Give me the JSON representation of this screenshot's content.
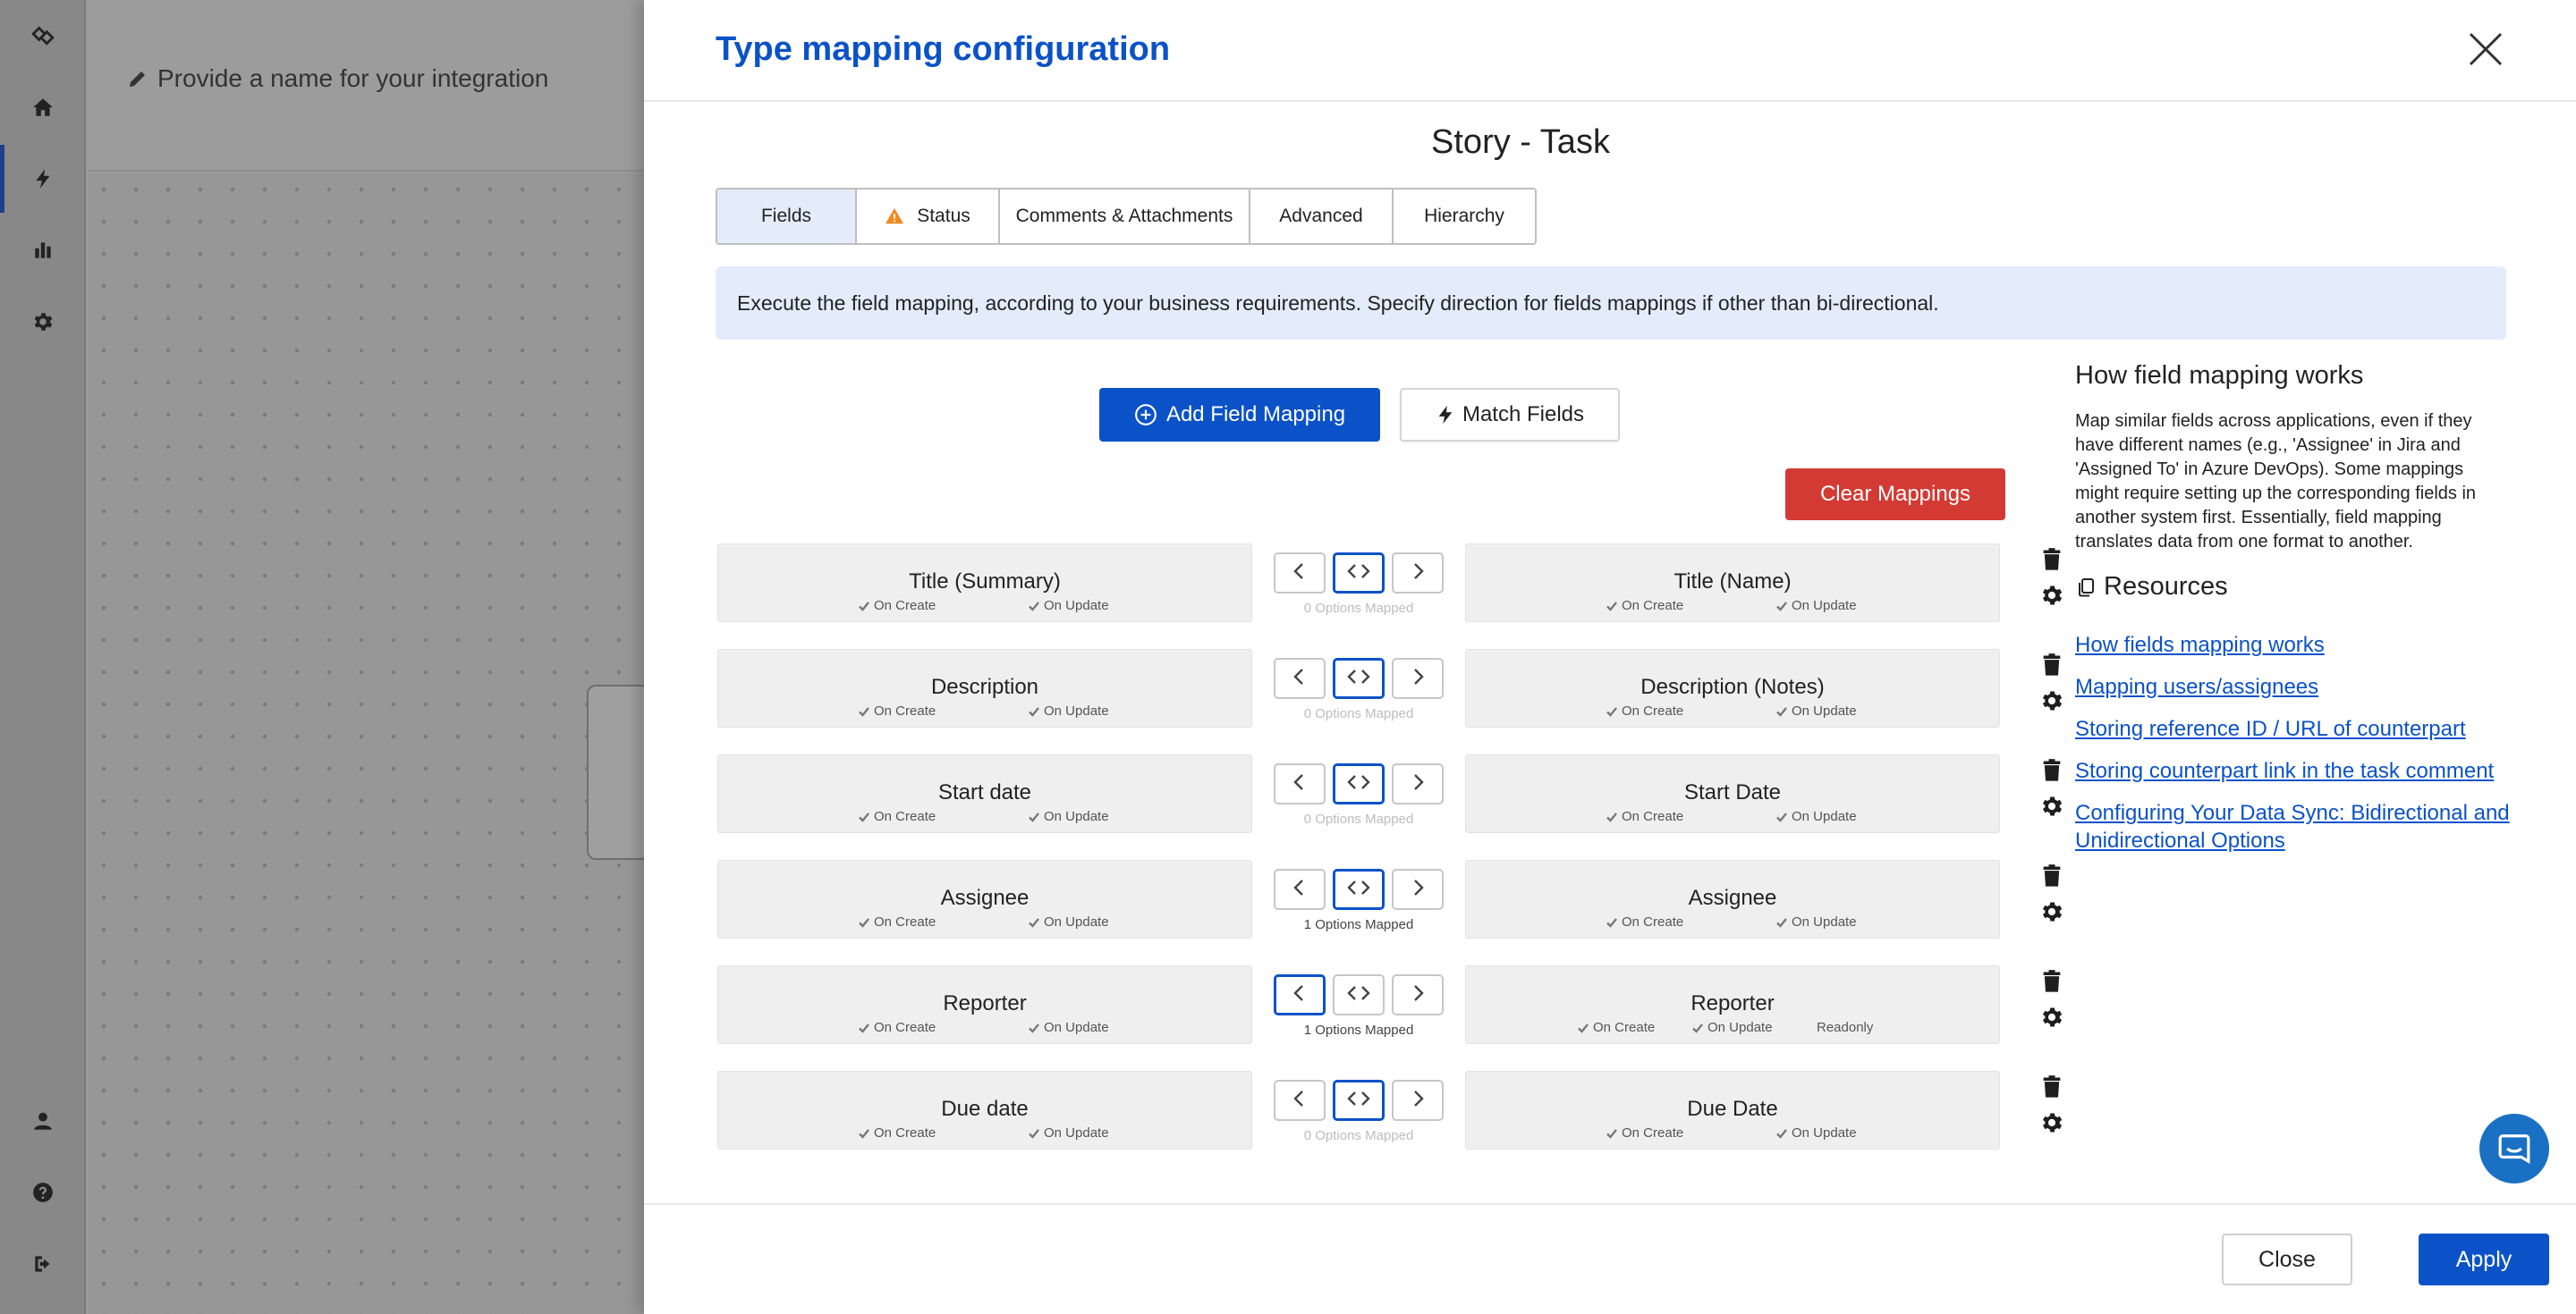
{
  "background": {
    "integration_name_placeholder": "Provide a name for your integration"
  },
  "modal": {
    "title": "Type mapping configuration",
    "subtitle": "Story - Task",
    "tabs": [
      {
        "label": "Fields",
        "active": true,
        "warning": false
      },
      {
        "label": "Status",
        "active": false,
        "warning": true
      },
      {
        "label": "Comments & Attachments",
        "active": false,
        "warning": false
      },
      {
        "label": "Advanced",
        "active": false,
        "warning": false
      },
      {
        "label": "Hierarchy",
        "active": false,
        "warning": false
      }
    ],
    "info_text": "Execute the field mapping, according to your business requirements. Specify direction for fields mappings if other than bi-directional.",
    "add_field_mapping_label": "Add Field Mapping",
    "match_fields_label": "Match Fields",
    "clear_mappings_label": "Clear Mappings",
    "flag_labels": {
      "on_create": "On Create",
      "on_update": "On Update",
      "readonly": "Readonly"
    },
    "mappings": [
      {
        "left": "Title (Summary)",
        "right": "Title (Name)",
        "direction": "both",
        "options": "0 Options Mapped",
        "readonly": false
      },
      {
        "left": "Description",
        "right": "Description (Notes)",
        "direction": "both",
        "options": "0 Options Mapped",
        "readonly": false
      },
      {
        "left": "Start date",
        "right": "Start Date",
        "direction": "both",
        "options": "0 Options Mapped",
        "readonly": false
      },
      {
        "left": "Assignee",
        "right": "Assignee",
        "direction": "both",
        "options": "1 Options Mapped",
        "readonly": false
      },
      {
        "left": "Reporter",
        "right": "Reporter",
        "direction": "left",
        "options": "1 Options Mapped",
        "readonly": true
      },
      {
        "left": "Due date",
        "right": "Due Date",
        "direction": "both",
        "options": "0 Options Mapped",
        "readonly": false
      }
    ],
    "help": {
      "title": "How field mapping works",
      "body": "Map similar fields across applications, even if they have different names (e.g., 'Assignee' in Jira and 'Assigned To' in Azure DevOps). Some mappings might require setting up the corresponding fields in another system first. Essentially, field mapping translates data from one format to another.",
      "resources_title": "Resources",
      "links": [
        "How fields mapping works",
        "Mapping users/assignees",
        "Storing reference ID / URL of counterpart",
        "Storing counterpart link in the task comment",
        "Configuring Your Data Sync: Bidirectional and Unidirectional Options"
      ]
    },
    "close_label": "Close",
    "apply_label": "Apply"
  },
  "colors": {
    "accent": "#0b52c8",
    "danger": "#d33a34",
    "info_bg": "#e2ecfb",
    "warning": "#f08a24"
  }
}
